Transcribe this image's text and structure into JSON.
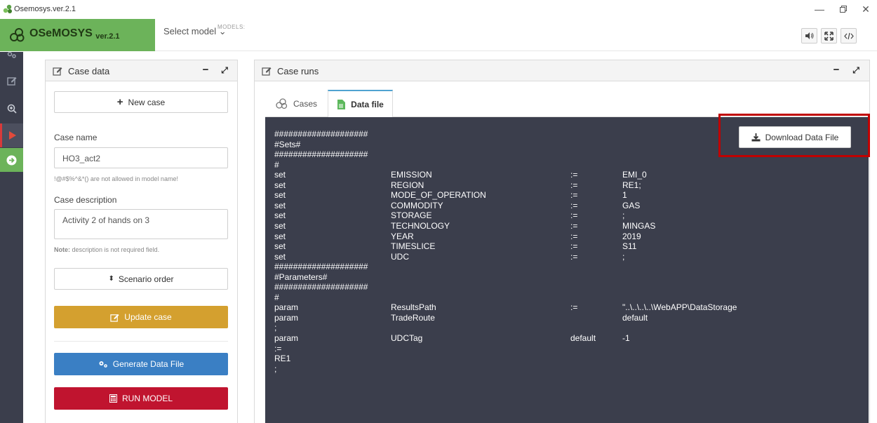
{
  "window": {
    "title": "Osemosys.ver.2.1"
  },
  "brand": {
    "name": "OSeMOSYS",
    "version": "ver.2.1"
  },
  "models": {
    "label": "MODELS:",
    "selected": "Select model ⌄"
  },
  "case_data": {
    "title": "Case data",
    "new_case": "New case",
    "case_name_label": "Case name",
    "case_name_value": "HO3_act2",
    "case_name_hint": "!@#$%^&*() are not allowed in model name!",
    "case_description_label": "Case description",
    "case_description_value": "Activity 2 of hands on 3",
    "note_bold": "Note:",
    "note_text": " description is not required field.",
    "scenario_order": "Scenario order",
    "update_case": "Update case",
    "generate_data_file": "Generate Data File",
    "run_model": "RUN MODEL"
  },
  "case_runs": {
    "title": "Case runs",
    "tabs": [
      {
        "label": "Cases"
      },
      {
        "label": "Data file"
      }
    ],
    "download": "Download Data File",
    "lines": [
      [
        "####################",
        "",
        "",
        ""
      ],
      [
        "#Sets#",
        "",
        "",
        ""
      ],
      [
        "####################",
        "",
        "",
        ""
      ],
      [
        "#",
        "",
        "",
        ""
      ],
      [
        "set",
        "EMISSION",
        ":=",
        "EMI_0"
      ],
      [
        "set",
        "REGION",
        ":=",
        "RE1;"
      ],
      [
        "set",
        "MODE_OF_OPERATION",
        ":=",
        "1"
      ],
      [
        "set",
        "COMMODITY",
        ":=",
        "GAS"
      ],
      [
        "set",
        "STORAGE",
        ":=",
        ";"
      ],
      [
        "set",
        "TECHNOLOGY",
        ":=",
        "MINGAS"
      ],
      [
        "set",
        "YEAR",
        ":=",
        "2019"
      ],
      [
        "set",
        "TIMESLICE",
        ":=",
        "S11"
      ],
      [
        "set",
        "UDC",
        ":=",
        ";"
      ],
      [
        "####################",
        "",
        "",
        ""
      ],
      [
        "#Parameters#",
        "",
        "",
        ""
      ],
      [
        "####################",
        "",
        "",
        ""
      ],
      [
        "#",
        "",
        "",
        ""
      ],
      [
        "param",
        "ResultsPath",
        ":=",
        "\"..\\..\\..\\..\\WebAPP\\DataStorage"
      ],
      [
        "param",
        "TradeRoute",
        "",
        "default"
      ],
      [
        ";",
        "",
        "",
        ""
      ],
      [
        "param",
        "UDCTag",
        "default",
        "-1"
      ],
      [
        ":=",
        "",
        "",
        ""
      ],
      [
        "RE1",
        "",
        "",
        ""
      ],
      [
        ";",
        "",
        "",
        ""
      ]
    ]
  }
}
